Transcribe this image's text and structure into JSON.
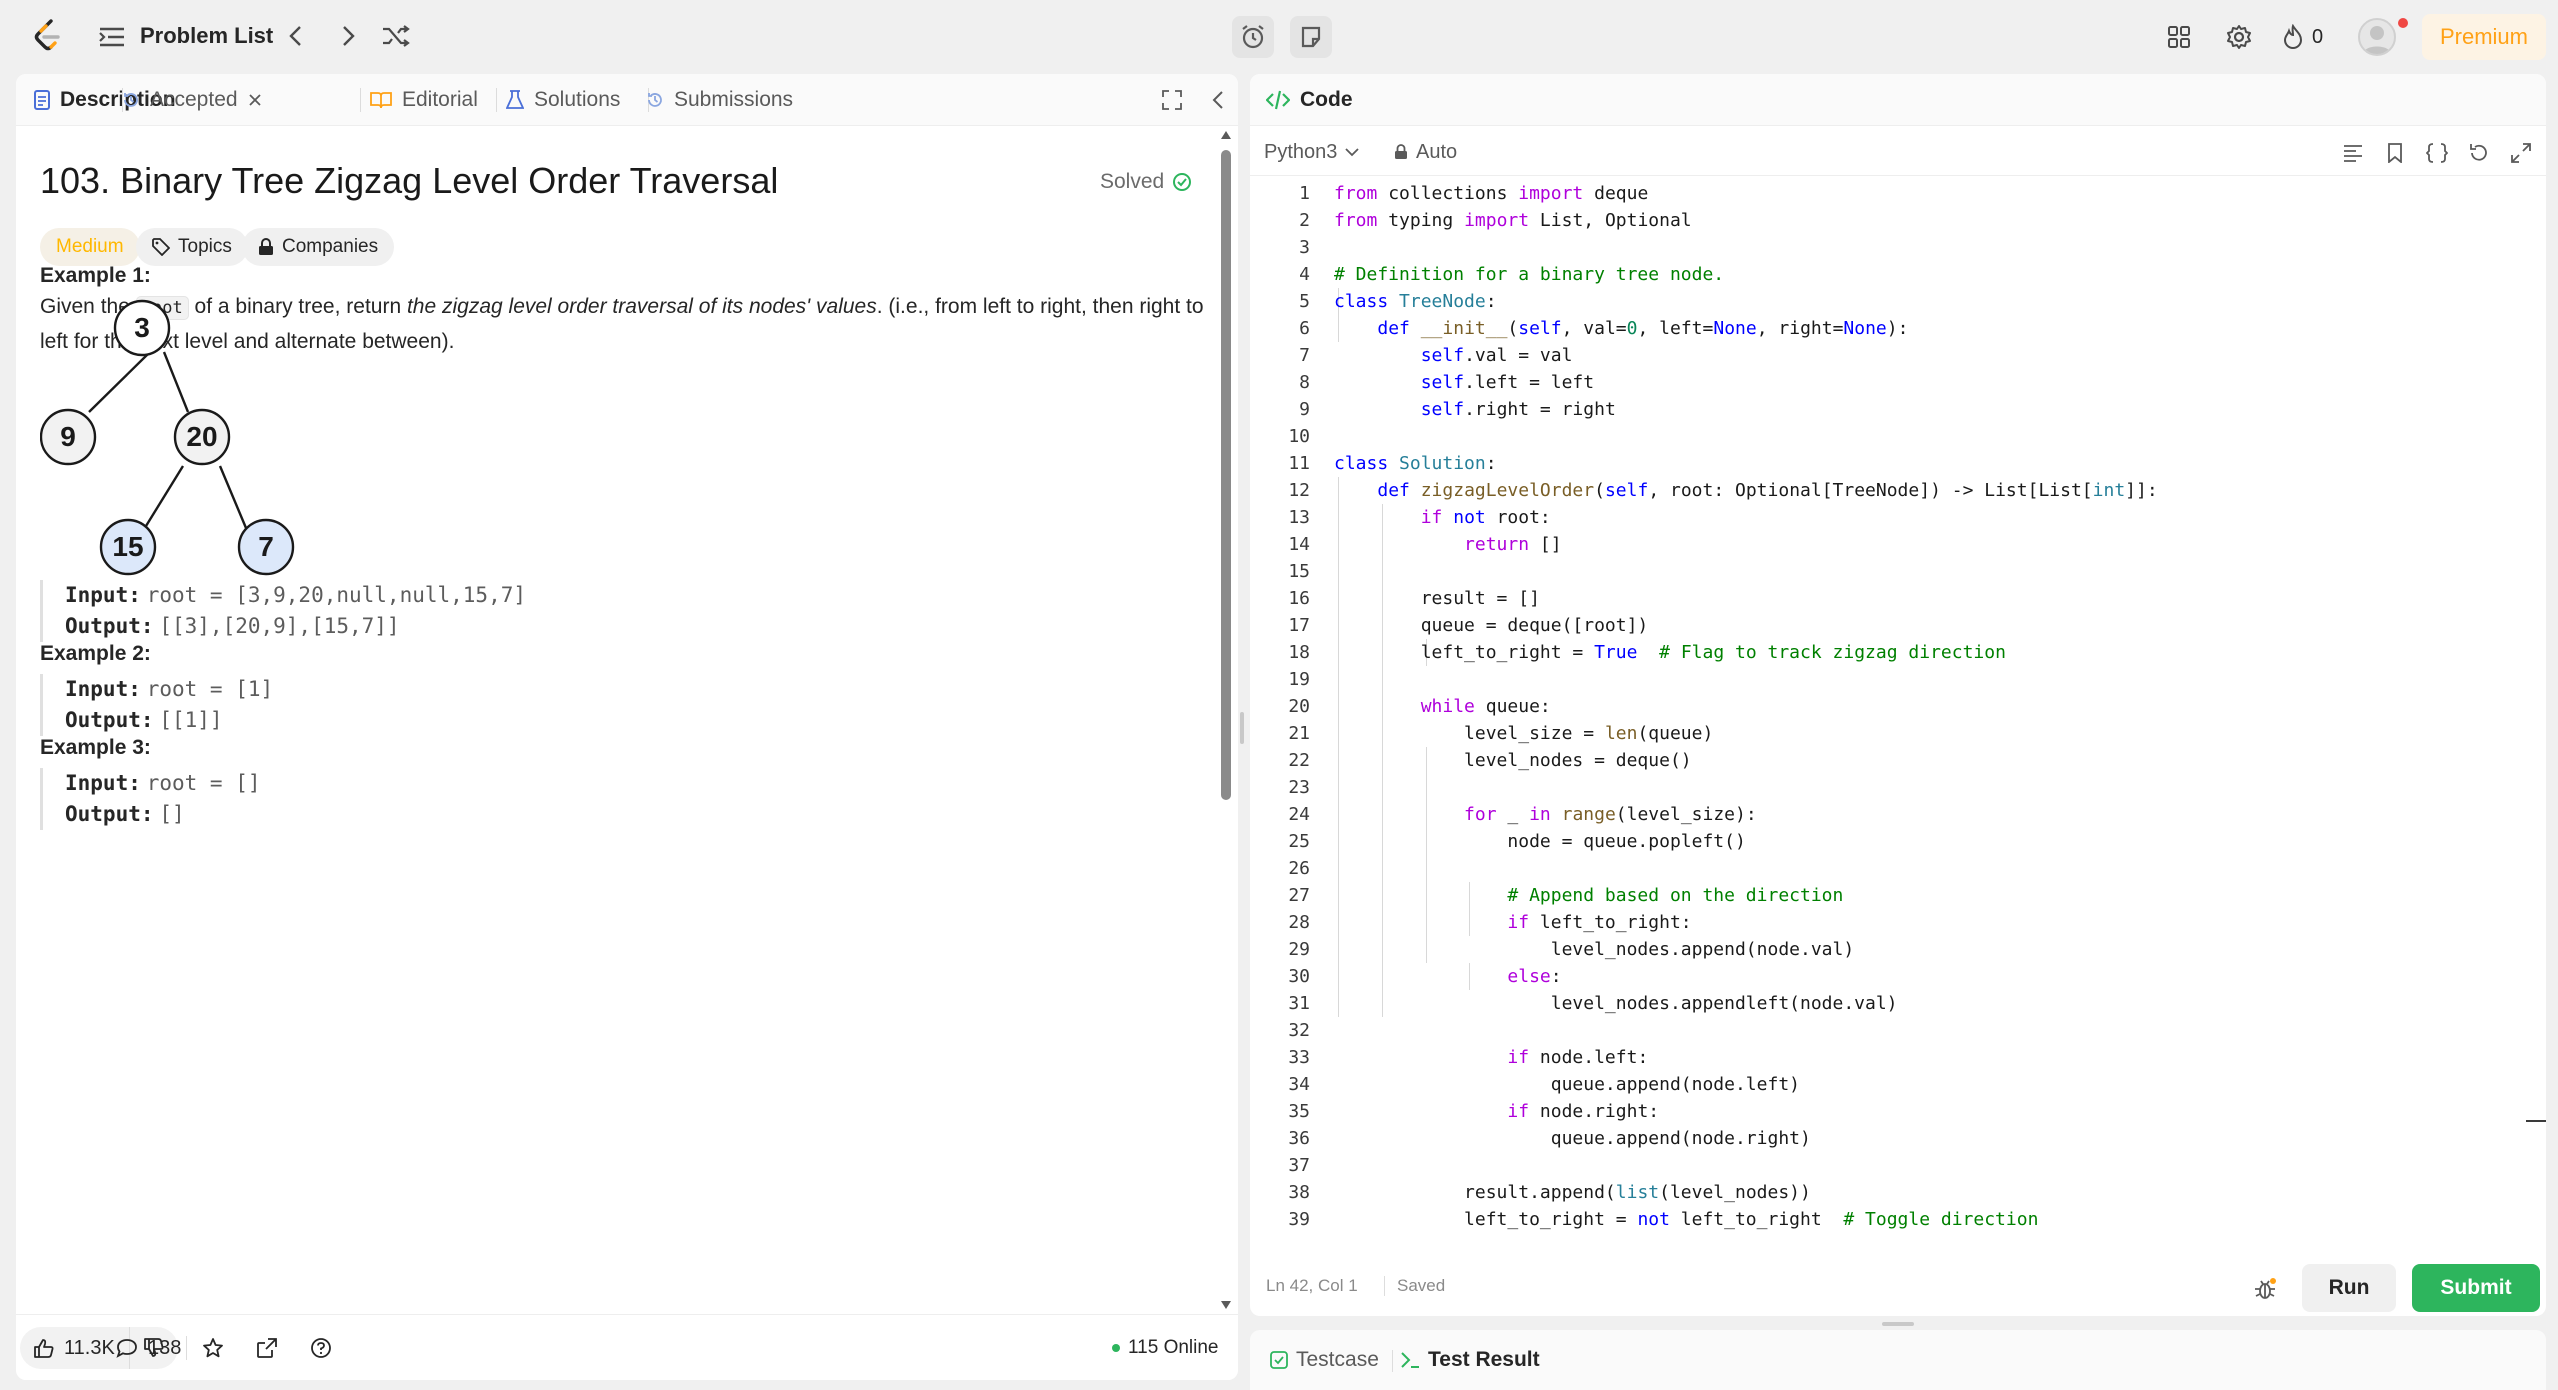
{
  "nav": {
    "problem_list": "Problem List",
    "streak_count": "0",
    "premium": "Premium"
  },
  "tabs": {
    "description": "Description",
    "accepted": "Accepted",
    "editorial": "Editorial",
    "solutions": "Solutions",
    "submissions": "Submissions"
  },
  "problem": {
    "title": "103. Binary Tree Zigzag Level Order Traversal",
    "status": "Solved",
    "difficulty": "Medium",
    "topics": "Topics",
    "companies": "Companies",
    "statement_pre": "Given the ",
    "statement_code": "root",
    "statement_mid": " of a binary tree, return ",
    "statement_em": "the zigzag level order traversal of its nodes' values",
    "statement_post": ". (i.e., from left to right, then right to left for the next level and alternate between)."
  },
  "examples": [
    {
      "title": "Example 1:",
      "input_label": "Input:",
      "input": "root = [3,9,20,null,null,15,7]",
      "output_label": "Output:",
      "output": "[[3],[20,9],[15,7]]"
    },
    {
      "title": "Example 2:",
      "input_label": "Input:",
      "input": "root = [1]",
      "output_label": "Output:",
      "output": "[[1]]"
    },
    {
      "title": "Example 3:",
      "input_label": "Input:",
      "input": "root = []",
      "output_label": "Output:",
      "output": "[]"
    }
  ],
  "tree": {
    "nodes": [
      "3",
      "9",
      "20",
      "15",
      "7"
    ]
  },
  "footer": {
    "likes": "11.3K",
    "comments": "138",
    "online": "115 Online"
  },
  "code": {
    "header": "Code",
    "language": "Python3",
    "mode": "Auto",
    "cursor": "Ln 42, Col 1",
    "saved": "Saved",
    "run": "Run",
    "submit": "Submit"
  },
  "bottom_tabs": {
    "testcase": "Testcase",
    "test_result": "Test Result"
  },
  "colors": {
    "accent": "#ffa116",
    "submit_green": "#2db55d",
    "medium_yellow": "#ffb800",
    "node_highlight": "#dce8fa"
  }
}
